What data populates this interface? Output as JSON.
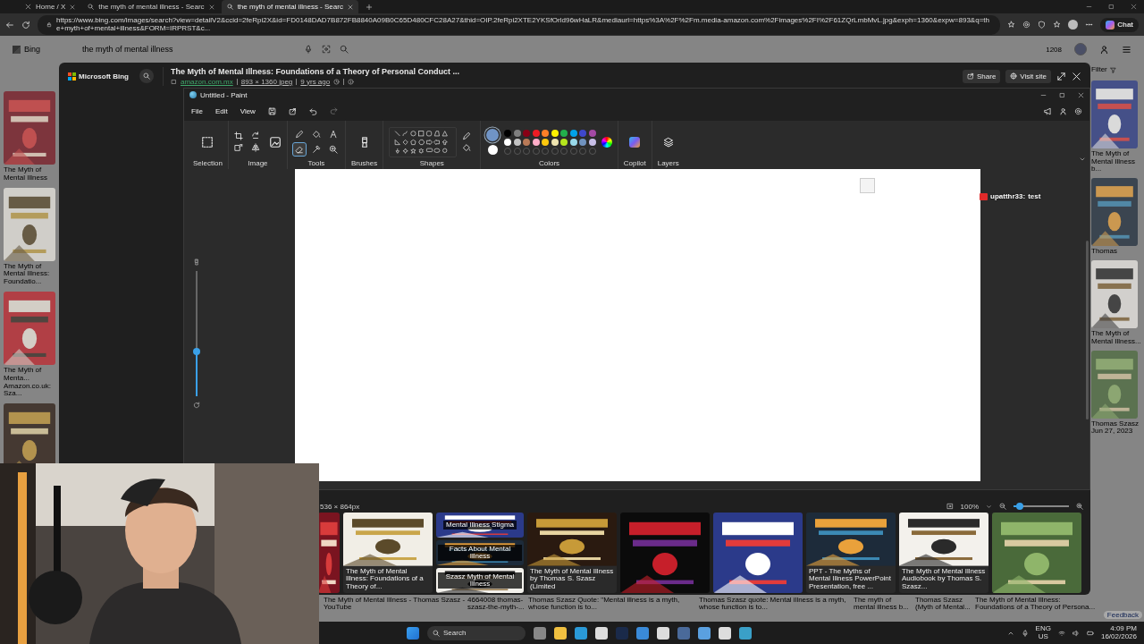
{
  "browser": {
    "tabs": [
      {
        "label": "Home / X",
        "selected": false,
        "kind": "x"
      },
      {
        "label": "the myth of mental illness - Searc",
        "selected": false,
        "kind": "bing"
      },
      {
        "label": "the myth of mental illness - Searc",
        "selected": true,
        "kind": "bing"
      }
    ],
    "url": "https://www.bing.com/images/search?view=detailV2&ccid=2feRpi2X&id=FD0148DAD7B872FB8840A09B0C65D480CFC28A27&thid=OIP.2feRpi2XTE2YKSfOrld96wHaLR&mediaurl=https%3A%2F%2Fm.media-amazon.com%2Fimages%2FI%2F61ZQrLmbMvL.jpg&exph=1360&expw=893&q=the+myth+of+mental+illness&FORM=IRPRST&c...",
    "chat_button": "Chat"
  },
  "bing_page": {
    "logo": "Bing",
    "search_value": "the myth of mental illness",
    "points": "1208",
    "filter": "Filter",
    "left_results": [
      {
        "kind": "captioned",
        "caption": "The Myth of Mental Illness"
      },
      {
        "kind": "captioned",
        "caption": "The Myth of Mental Illness: Foundatio..."
      },
      {
        "kind": "captioned",
        "caption": "The Myth of Menta... Amazon.co.uk: Sza..."
      },
      {
        "kind": "picture"
      }
    ],
    "right_results": [
      {
        "caption": "The Myth of Mental Illness b..."
      },
      {
        "caption": "Thomas"
      },
      {
        "caption": "The Myth of Mental Illness..."
      },
      {
        "caption": "Thomas Szasz Jun 27, 2023"
      }
    ],
    "bottom_captions": [
      "The Myth of Mental Illness - Thomas Szasz - YouTube",
      "4664008 thomas-szasz-the-myth-...",
      "Thomas Szasz Quote: \"Mental illness is a myth, whose function is to...",
      "Thomas Szasz quote: Mental illness is a myth, whose function is to...",
      "The myth of mental illness b...",
      "Thomas Szasz (Myth of Mental...",
      "The Myth of Mental Illness: Foundations of a Theory of Persona..."
    ],
    "feedback": "Feedback"
  },
  "detail": {
    "brand": "Microsoft Bing",
    "title": "The Myth of Mental Illness: Foundations of a Theory of Personal Conduct ...",
    "source": "amazon.com.mx",
    "size": "893 × 1360 jpeg",
    "age": "9 yrs ago",
    "share": "Share",
    "visit": "Visit site",
    "dimensions": "536 × 864px",
    "zoom": "100%",
    "zoom_slider": {
      "level": 0.12
    },
    "filmstrip": [
      {
        "kind": "picture"
      },
      {
        "kind": "captioned",
        "caption": "The Myth of Mental Illness: Foundations of a Theory of..."
      },
      {
        "kind": "stack",
        "tiles": [
          {
            "caption": "Mental Illness Stigma"
          },
          {
            "caption": "Facts About Mental Illness"
          },
          {
            "caption": "Szasz Myth of Mental Illness"
          }
        ]
      },
      {
        "kind": "captioned",
        "caption": "The Myth of Mental Illness by Thomas S. Szasz (Limited"
      },
      {
        "kind": "picture"
      },
      {
        "kind": "picture"
      },
      {
        "kind": "captioned",
        "caption": "PPT - The Myths of Mental Illness PowerPoint Presentation, free ..."
      },
      {
        "kind": "captioned",
        "caption": "The Myth of Mental Illness Audiobook by Thomas S. Szasz..."
      },
      {
        "kind": "picture"
      }
    ]
  },
  "paint": {
    "title": "Untitled - Paint",
    "menus": [
      "File",
      "Edit",
      "View"
    ],
    "groups": [
      "Selection",
      "Image",
      "Tools",
      "Brushes",
      "Shapes",
      "Colors",
      "Copilot",
      "Layers"
    ],
    "tools": [
      {
        "kind": "pencil",
        "selected": false
      },
      {
        "kind": "fill",
        "selected": false
      },
      {
        "kind": "text",
        "selected": false
      },
      {
        "kind": "eraser",
        "selected": true
      },
      {
        "kind": "picker",
        "selected": false
      },
      {
        "kind": "magnifier",
        "selected": false
      }
    ],
    "current_colors": [
      {
        "color": "#7094c6",
        "selected": true
      },
      {
        "color": "#ffffff",
        "selected": false
      }
    ],
    "palette": [
      {
        "color": "#000000"
      },
      {
        "color": "#7f7f7f"
      },
      {
        "color": "#880015"
      },
      {
        "color": "#ed1c24"
      },
      {
        "color": "#ff7f27"
      },
      {
        "color": "#fff200"
      },
      {
        "color": "#22b14c"
      },
      {
        "color": "#00a2e8"
      },
      {
        "color": "#3f48cc"
      },
      {
        "color": "#a349a4"
      },
      {
        "color": "#ffffff"
      },
      {
        "color": "#c3c3c3"
      },
      {
        "color": "#b97a57"
      },
      {
        "color": "#ffaec9"
      },
      {
        "color": "#ffc90e"
      },
      {
        "color": "#efe4b0"
      },
      {
        "color": "#b5e61d"
      },
      {
        "color": "#99d9ea"
      },
      {
        "color": "#7092be"
      },
      {
        "color": "#c8bfe7"
      }
    ],
    "size_slider": {
      "level": 0.36
    }
  },
  "stream": {
    "chat_user": "upatthr33:",
    "chat_message": "test"
  },
  "taskbar": {
    "search": "Search",
    "language": "ENG",
    "region": "US",
    "time": "4:09 PM",
    "date": "16/02/2026"
  }
}
